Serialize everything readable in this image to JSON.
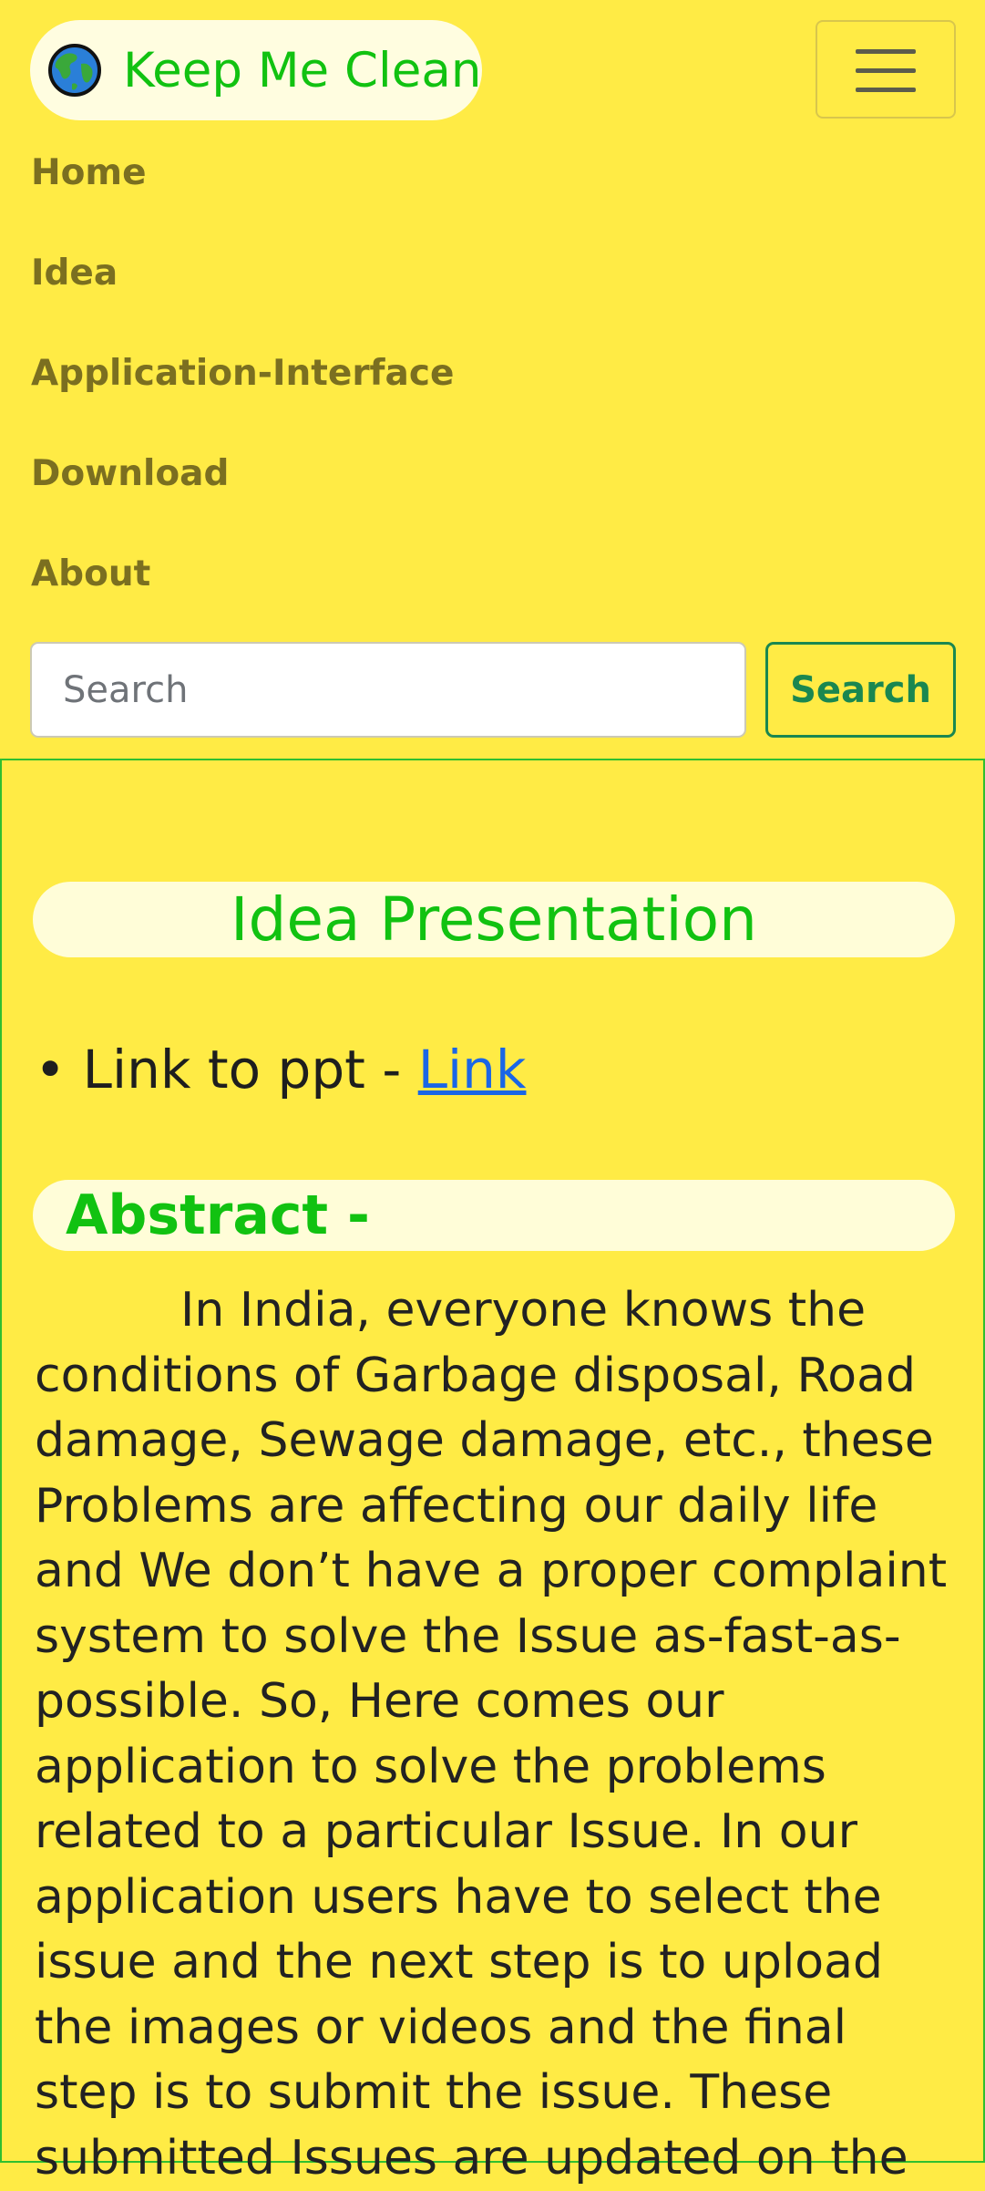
{
  "navbar": {
    "brand": {
      "icon": "globe-icon",
      "label": "Keep Me Clean"
    },
    "toggler_icon": "hamburger-menu-icon",
    "links": [
      {
        "label": "Home"
      },
      {
        "label": "Idea"
      },
      {
        "label": "Application-Interface"
      },
      {
        "label": "Download"
      },
      {
        "label": "About"
      }
    ],
    "search": {
      "placeholder": "Search",
      "value": "",
      "button_label": "Search"
    }
  },
  "main": {
    "title": "Idea Presentation",
    "ppt": {
      "prefix": "• Link to ppt - ",
      "link_label": "Link"
    },
    "abstract": {
      "heading": "Abstract -",
      "body": "In India, everyone knows the conditions of Garbage disposal, Road damage, Sewage damage, etc., these Problems are affecting our daily life and We don’t have a proper complaint system to solve the Issue as-fast-as-possible. So, Here comes our application to solve the problems related to a particular Issue. In our application users have to select the issue and the next step is to upload the images or videos and the final step is to submit the issue. These submitted Issues are updated on the"
    }
  },
  "colors": {
    "background": "#ffeb45",
    "brand_green": "#11c211",
    "nav_link": "#7b6f20",
    "search_button": "#1a8750",
    "link_blue": "#1a66e6"
  }
}
